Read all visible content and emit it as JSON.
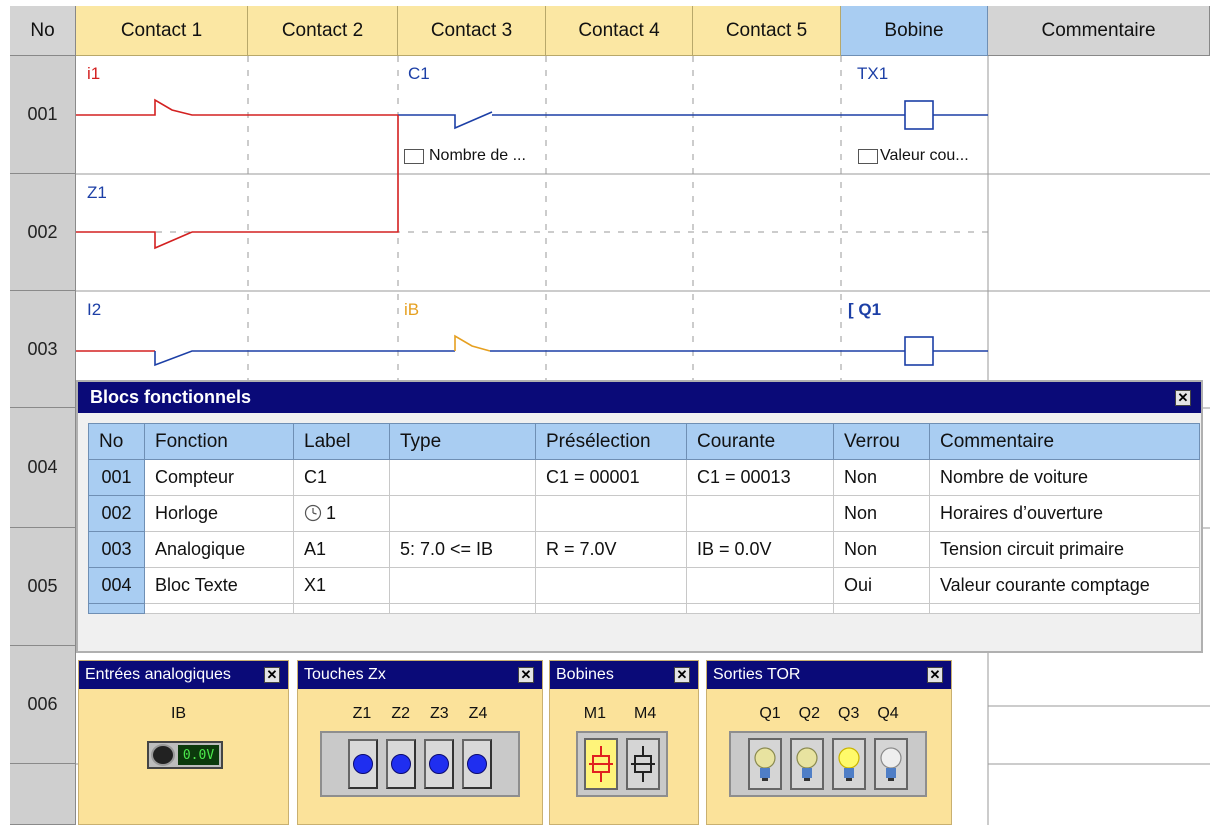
{
  "columns": {
    "no": "No",
    "contacts": [
      "Contact 1",
      "Contact 2",
      "Contact 3",
      "Contact 4",
      "Contact 5"
    ],
    "bobine": "Bobine",
    "commentaire": "Commentaire"
  },
  "rows": [
    "001",
    "002",
    "003",
    "004",
    "005",
    "006"
  ],
  "rungs": {
    "r1": {
      "contact1": "i1",
      "contact3": "C1",
      "coil": "TX1",
      "comment3": "Nombre de ...",
      "comment_coil": "Valeur cou..."
    },
    "r2": {
      "contact1": "Z1"
    },
    "r3": {
      "contact1": "I2",
      "contact3": "iB",
      "coil": "[ Q1"
    }
  },
  "blocs": {
    "title": "Blocs fonctionnels",
    "close": "✕",
    "headers": [
      "No",
      "Fonction",
      "Label",
      "Type",
      "Présélection",
      "Courante",
      "Verrou",
      "Commentaire"
    ],
    "rows": [
      [
        "001",
        "Compteur",
        "C1",
        "",
        "C1 = 00001",
        "C1 = 00013",
        "Non",
        "Nombre de voiture"
      ],
      [
        "002",
        "Horloge",
        "1",
        "",
        "",
        "",
        "Non",
        "Horaires d’ouverture"
      ],
      [
        "003",
        "Analogique",
        "A1",
        "5: 7.0 <= IB",
        "R = 7.0V",
        "IB = 0.0V",
        "Non",
        "Tension circuit primaire"
      ],
      [
        "004",
        "Bloc Texte",
        "X1",
        "",
        "",
        "",
        "Oui",
        "Valeur courante comptage"
      ]
    ]
  },
  "palettes": {
    "analog": {
      "title": "Entrées analogiques",
      "label": "IB",
      "display": "0.0V"
    },
    "touches": {
      "title": "Touches Zx",
      "labels": [
        "Z1",
        "Z2",
        "Z3",
        "Z4"
      ]
    },
    "bobines": {
      "title": "Bobines",
      "labels": [
        "M1",
        "M4"
      ]
    },
    "sorties": {
      "title": "Sorties TOR",
      "labels": [
        "Q1",
        "Q2",
        "Q3",
        "Q4"
      ]
    }
  },
  "colors": {
    "active": "#d32020",
    "inactive": "#1c3fa6",
    "header_contact": "#fbe7a3",
    "header_bobine": "#a9cdf2",
    "titlebar": "#0a0a78"
  }
}
